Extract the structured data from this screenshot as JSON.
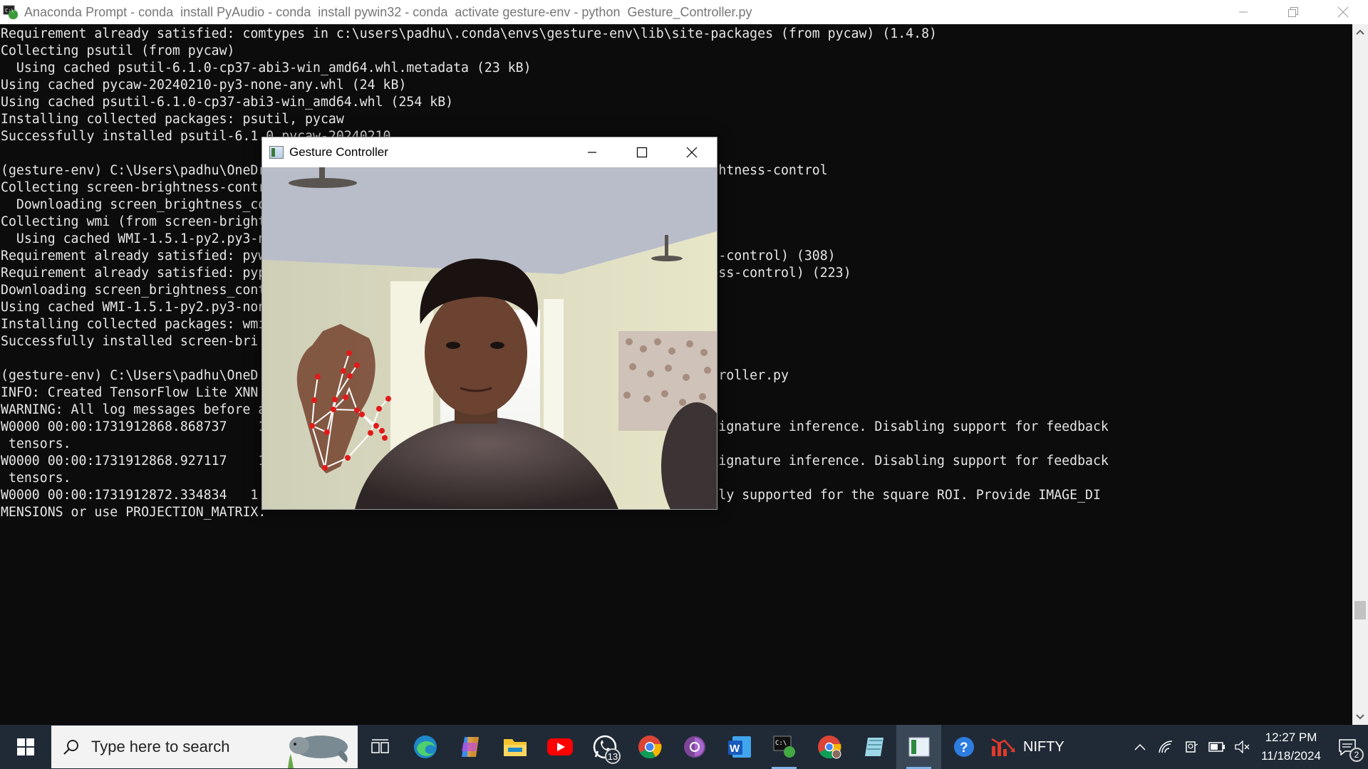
{
  "console": {
    "title": "Anaconda Prompt - conda  install PyAudio - conda  install pywin32 - conda  activate gesture-env - python  Gesture_Controller.py",
    "lines": [
      "Requirement already satisfied: comtypes in c:\\users\\padhu\\.conda\\envs\\gesture-env\\lib\\site-packages (from pycaw) (1.4.8)",
      "Collecting psutil (from pycaw)",
      "  Using cached psutil-6.1.0-cp37-abi3-win_amd64.whl.metadata (23 kB)",
      "Using cached pycaw-20240210-py3-none-any.whl (24 kB)",
      "Using cached psutil-6.1.0-cp37-abi3-win_amd64.whl (254 kB)",
      "Installing collected packages: psutil, pycaw",
      "Successfully installed psutil-6.1.0 pycaw-20240210",
      "",
      "(gesture-env) C:\\Users\\padhu\\OneDrive\\                  use-main\\src>pip install screen-brightness-control",
      "Collecting screen-brightness-control",
      "  Downloading screen_brightness_co",
      "Collecting wmi (from screen-brightne",
      "  Using cached WMI-1.5.1-py2.py3-no",
      "Requirement already satisfied: pyw                           ackages (from screen-brightness-control) (308)",
      "Requirement already satisfied: pyp                           -packages (from screen-brightness-control) (223)",
      "Downloading screen_brightness_cont",
      "Using cached WMI-1.5.1-py2.py3-non",
      "Installing collected packages: wmi",
      "Successfully installed screen-bri",
      "",
      "(gesture-env) C:\\Users\\padhu\\OneD                           use-main\\src>python Gesture_Controller.py",
      "INFO: Created TensorFlow Lite XNN",
      "WARNING: All log messages before a",
      "W0000 00:00:1731912868.868737    1                           equires a model with a single signature inference. Disabling support for feedback",
      " tensors.",
      "W0000 00:00:1731912868.927117    1                           equires a model with a single signature inference. Disabling support for feedback",
      " tensors.",
      "W0000 00:00:1731912872.334834   1                           T without IMAGE_DIMENSIONS is only supported for the square ROI. Provide IMAGE_DI",
      "MENSIONS or use PROJECTION_MATRIX."
    ]
  },
  "gesture_window": {
    "title": "Gesture Controller"
  },
  "taskbar": {
    "search_placeholder": "Type here to search",
    "apps": [
      {
        "name": "task-view-icon"
      },
      {
        "name": "edge-icon"
      },
      {
        "name": "copilot-icon"
      },
      {
        "name": "file-explorer-icon"
      },
      {
        "name": "youtube-icon"
      },
      {
        "name": "whatsapp-icon",
        "badge": "13"
      },
      {
        "name": "chrome-icon"
      },
      {
        "name": "tor-browser-icon"
      },
      {
        "name": "word-icon"
      },
      {
        "name": "anaconda-prompt-icon"
      },
      {
        "name": "chrome-profile-icon"
      },
      {
        "name": "notepad-icon"
      },
      {
        "name": "gesture-controller-icon"
      },
      {
        "name": "help-icon"
      }
    ],
    "widget_label": "NIFTY",
    "time": "12:27 PM",
    "date": "11/18/2024",
    "notification_count": "2"
  },
  "colors": {
    "console_bg": "#0c0c0c",
    "console_fg": "#e6e6e6",
    "taskbar_bg": "#1f2a36",
    "landmark_red": "#e11b1b"
  }
}
